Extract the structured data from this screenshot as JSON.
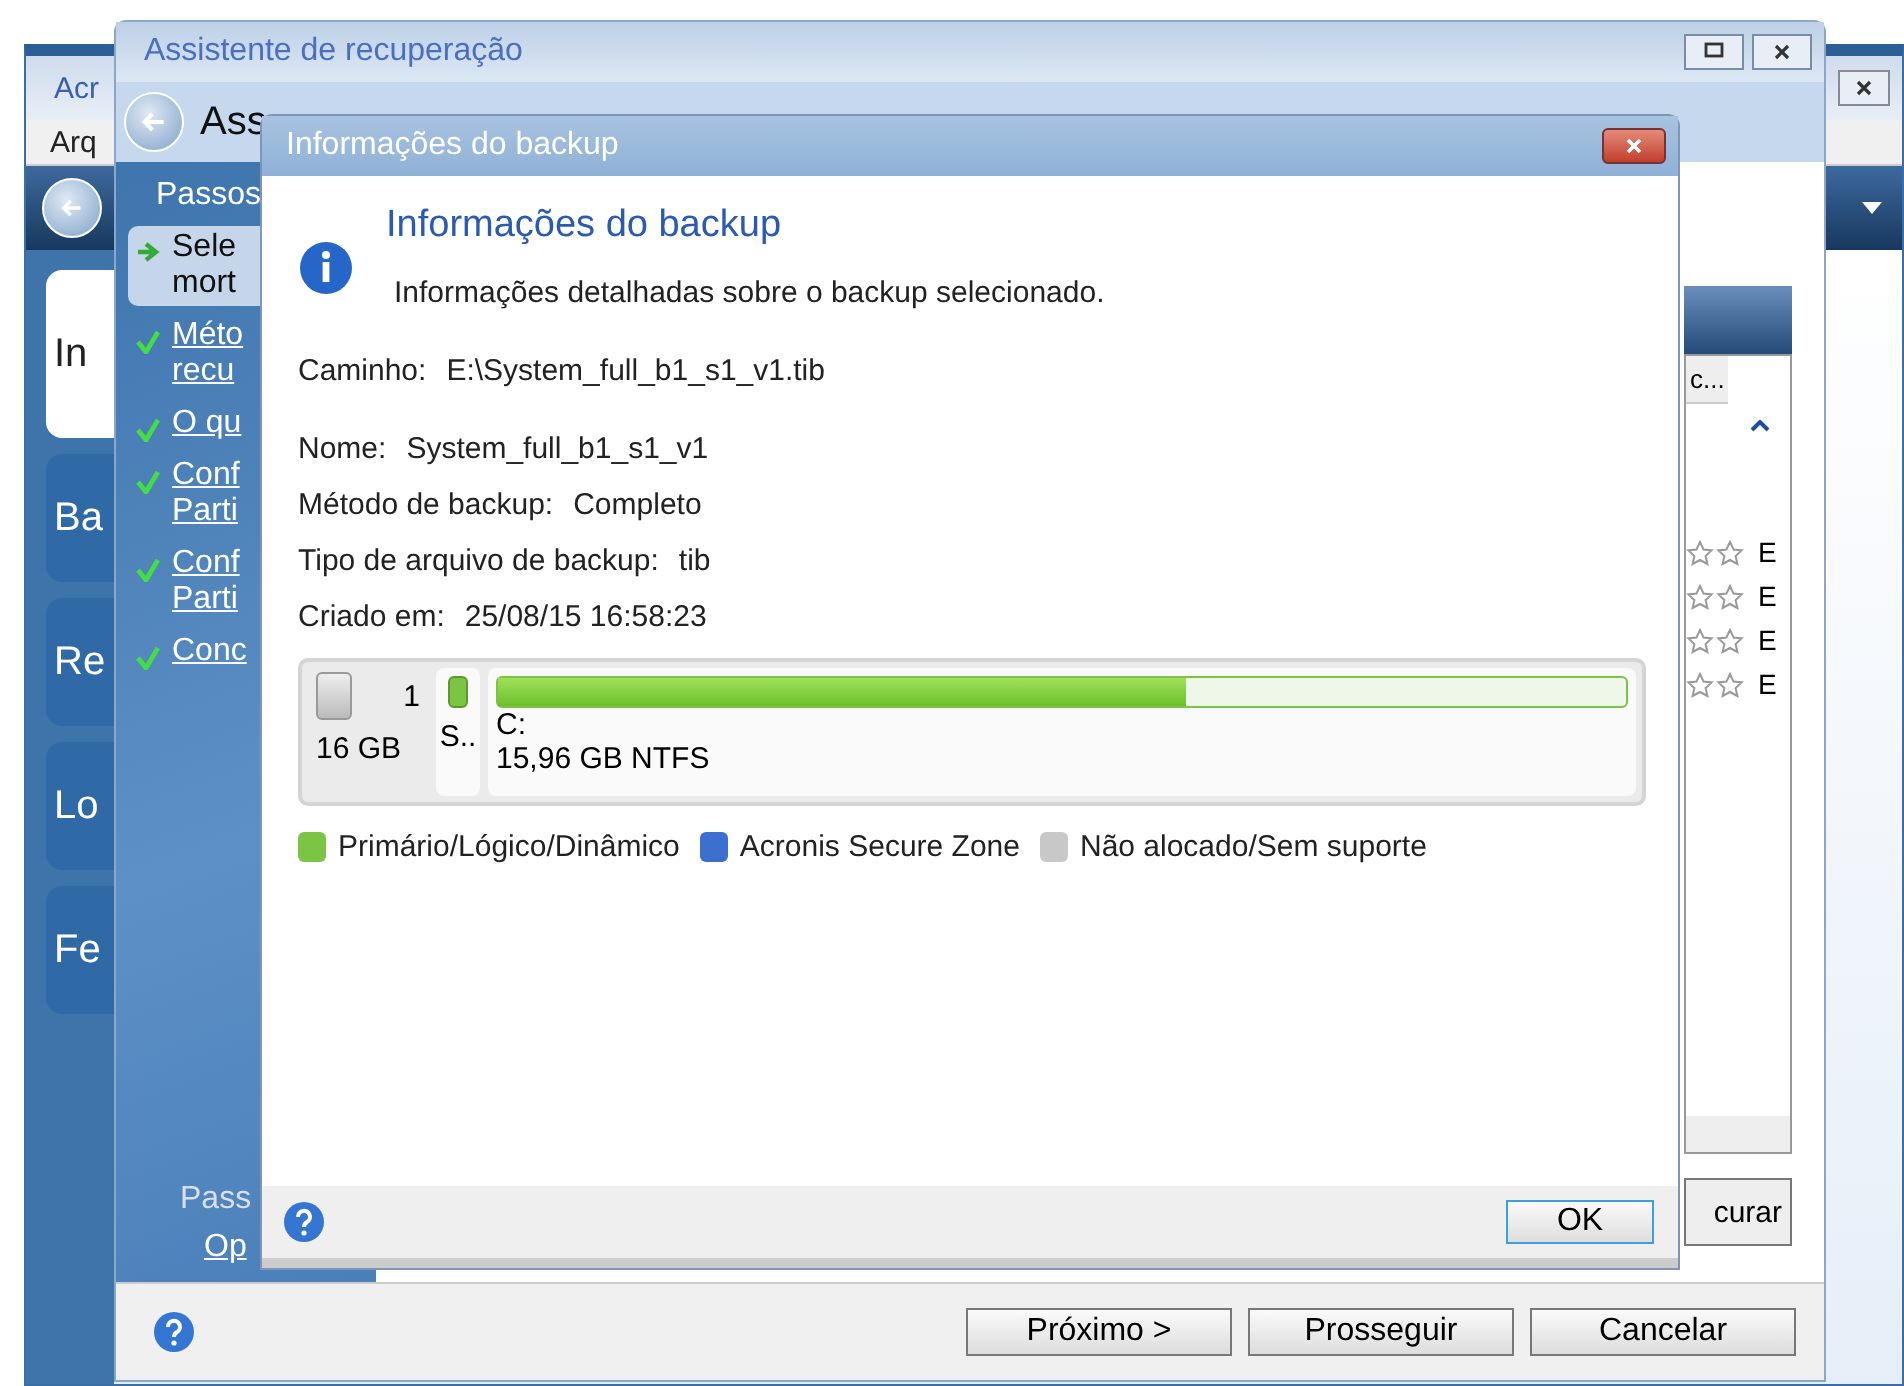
{
  "main_window": {
    "title": "Acr",
    "menu": "Arq",
    "sidebar": [
      "In",
      "Ba",
      "Re",
      "Lo",
      "Fe"
    ],
    "list_header": "c...",
    "list_rows": [
      "E",
      "E",
      "E",
      "E"
    ],
    "button": "curar"
  },
  "wizard": {
    "title": "Assistente de recuperação",
    "header": "Ass",
    "steps_label": "Passos",
    "steps": [
      {
        "lines": [
          "Sele",
          "mort"
        ],
        "selected": true
      },
      {
        "lines": [
          "Méto",
          "recu"
        ],
        "selected": false
      },
      {
        "lines": [
          "O qu"
        ],
        "selected": false
      },
      {
        "lines": [
          "Conf",
          "Parti"
        ],
        "selected": false
      },
      {
        "lines": [
          "Conf",
          "Parti"
        ],
        "selected": false
      },
      {
        "lines": [
          "Conc"
        ],
        "selected": false
      }
    ],
    "footer_label": "Pass",
    "footer_link": "Op",
    "buttons": [
      "Próximo >",
      "Prosseguir",
      "Cancelar"
    ]
  },
  "dialog": {
    "title": "Informações do backup",
    "heading": "Informações do backup",
    "description": "Informações detalhadas sobre o backup selecionado.",
    "path": {
      "label": "Caminho:",
      "value": "E:\\System_full_b1_s1_v1.tib"
    },
    "fields": [
      {
        "label": "Nome:",
        "value": "System_full_b1_s1_v1"
      },
      {
        "label": "Método de backup:",
        "value": "Completo"
      },
      {
        "label": "Tipo de arquivo de backup:",
        "value": "tib"
      },
      {
        "label": "Criado em:",
        "value": "25/08/15 16:58:23"
      }
    ],
    "disk": {
      "number": "1",
      "size": "16 GB",
      "small_partition": "S..",
      "partition": {
        "name": "C:",
        "info": "15,96 GB  NTFS",
        "level": 0.61
      }
    },
    "legend": [
      {
        "label": "Primário/Lógico/Dinâmico",
        "color": "#7cc444"
      },
      {
        "label": "Acronis Secure Zone",
        "color": "#3c6fd0"
      },
      {
        "label": "Não alocado/Sem suporte",
        "color": "#c8c8c8"
      }
    ],
    "ok": "OK"
  }
}
